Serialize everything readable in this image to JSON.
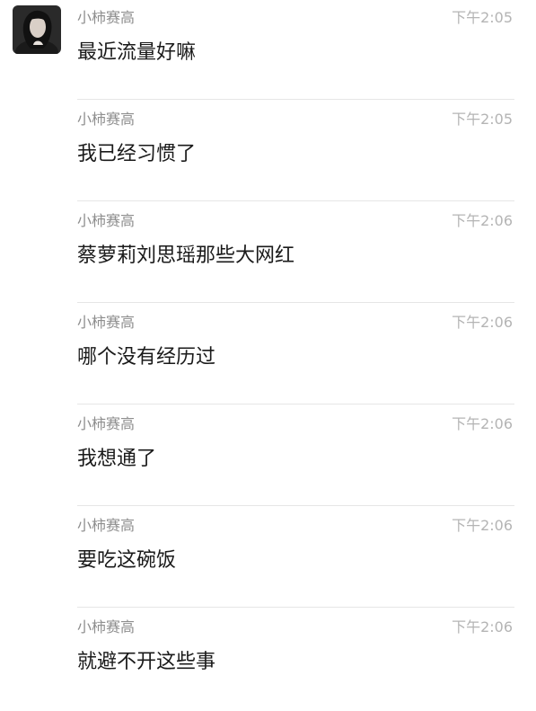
{
  "messages": [
    {
      "sender": "小柿赛高",
      "time": "下午2:05",
      "text": "最近流量好嘛"
    },
    {
      "sender": "小柿赛高",
      "time": "下午2:05",
      "text": "我已经习惯了"
    },
    {
      "sender": "小柿赛高",
      "time": "下午2:06",
      "text": "蔡萝莉刘思瑶那些大网红"
    },
    {
      "sender": "小柿赛高",
      "time": "下午2:06",
      "text": "哪个没有经历过"
    },
    {
      "sender": "小柿赛高",
      "time": "下午2:06",
      "text": "我想通了"
    },
    {
      "sender": "小柿赛高",
      "time": "下午2:06",
      "text": "要吃这碗饭"
    },
    {
      "sender": "小柿赛高",
      "time": "下午2:06",
      "text": "就避不开这些事"
    }
  ],
  "avatar": {
    "icon": "user-avatar-photo"
  },
  "colors": {
    "sender": "#8e8e8e",
    "time": "#b4b4b4",
    "text": "#1a1a1a",
    "divider": "#e6e6e6"
  }
}
